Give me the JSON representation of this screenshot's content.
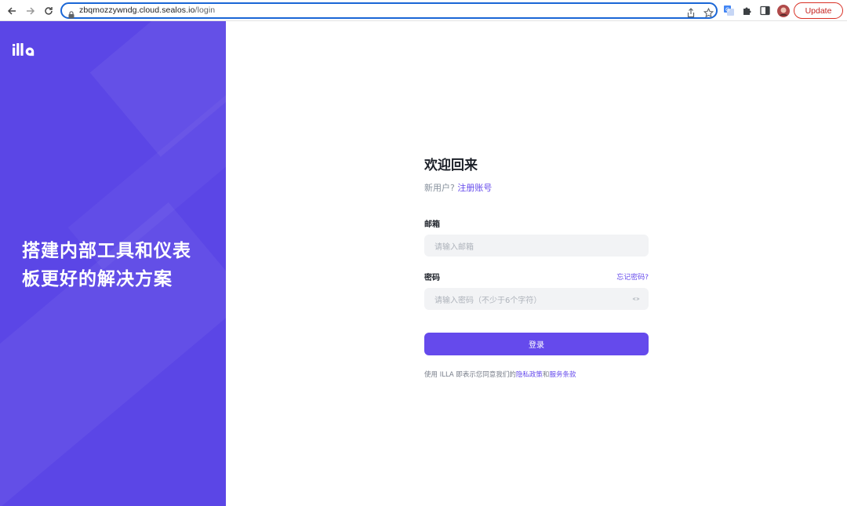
{
  "browser": {
    "url_host": "zbqmozzywndg.cloud.sealos.io",
    "url_path": "/login",
    "update_label": "Update",
    "icons": [
      "back-icon",
      "forward-icon",
      "reload-icon",
      "lock-icon",
      "share-icon",
      "bookmark-star-icon",
      "translate-icon",
      "extensions-puzzle-icon",
      "side-panel-icon",
      "profile-avatar"
    ]
  },
  "left_panel": {
    "logo_text": "illa",
    "slogan_line1": "搭建内部工具和仪表",
    "slogan_line2": "板更好的解决方案",
    "bg_color": "#5b46e6"
  },
  "login": {
    "title": "欢迎回来",
    "new_user_prompt": "新用户?",
    "register_link": "注册账号",
    "email_label": "邮箱",
    "email_placeholder": "请输入邮箱",
    "password_label": "密码",
    "forgot_link": "忘记密码?",
    "password_placeholder": "请输入密码（不少于6个字符）",
    "submit_label": "登录",
    "terms_prefix": "使用 ILLA 即表示您同意我们的",
    "privacy_link": "隐私政策",
    "terms_and": "和",
    "service_link": "服务条款",
    "accent_color": "#654aec"
  }
}
